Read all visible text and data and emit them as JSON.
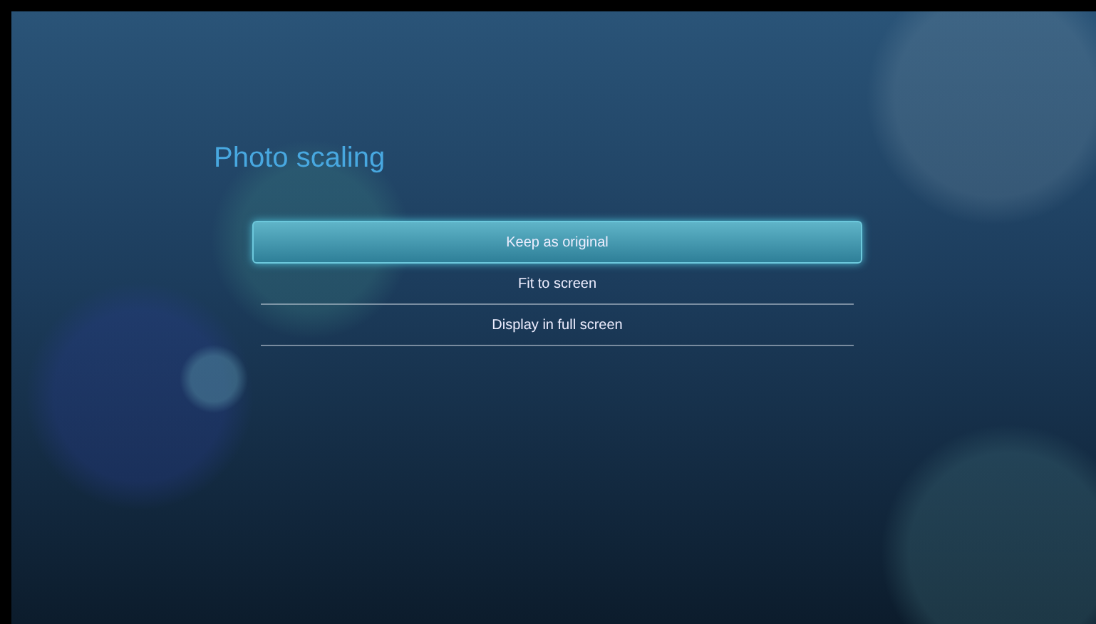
{
  "title": "Photo scaling",
  "options": [
    {
      "label": "Keep as original",
      "selected": true
    },
    {
      "label": "Fit to screen",
      "selected": false
    },
    {
      "label": "Display in full screen",
      "selected": false
    }
  ]
}
